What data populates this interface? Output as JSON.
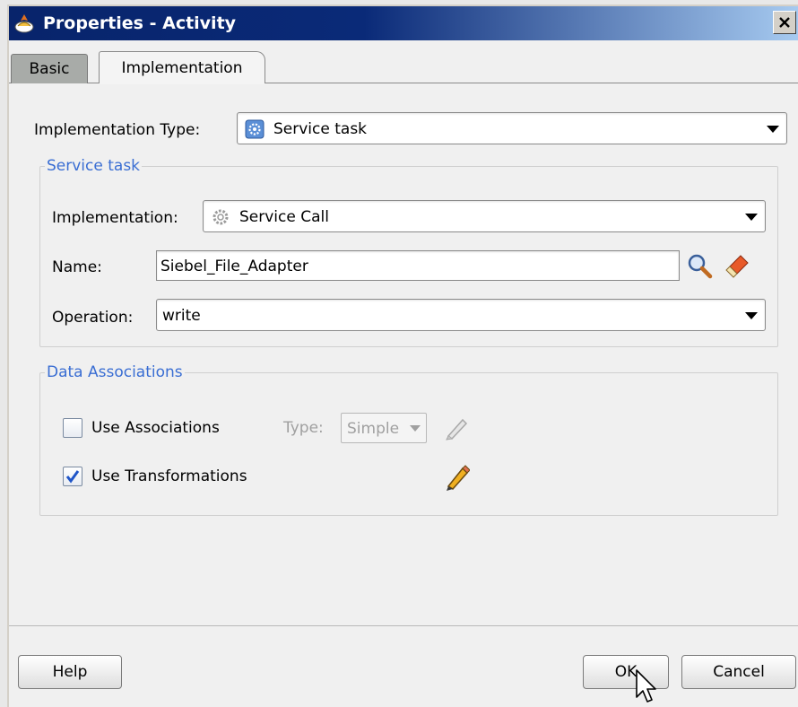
{
  "window": {
    "title": "Properties - Activity",
    "close_label": "✕"
  },
  "tabs": [
    {
      "label": "Basic",
      "active": false
    },
    {
      "label": "Implementation",
      "active": true
    }
  ],
  "implementation_type": {
    "label": "Implementation Type:",
    "value": "Service task"
  },
  "service_task": {
    "title": "Service task",
    "implementation_label": "Implementation:",
    "implementation_value": "Service Call",
    "name_label": "Name:",
    "name_value": "Siebel_File_Adapter",
    "operation_label": "Operation:",
    "operation_value": "write"
  },
  "data_associations": {
    "title": "Data Associations",
    "use_associations_label": "Use Associations",
    "use_associations_checked": false,
    "type_label": "Type:",
    "type_value": "Simple",
    "use_transformations_label": "Use Transformations",
    "use_transformations_checked": true
  },
  "buttons": {
    "help": "Help",
    "ok": "OK",
    "cancel": "Cancel"
  },
  "colors": {
    "title_start": "#08246b",
    "title_end": "#a6caf0",
    "group_title": "#3a6ed3",
    "check": "#1f55c8"
  },
  "icons": [
    "app-icon",
    "close-icon",
    "cog-icon",
    "search-icon",
    "eraser-icon",
    "pencil-icon",
    "checkmark-icon",
    "chevron-down-icon",
    "cursor-icon"
  ]
}
